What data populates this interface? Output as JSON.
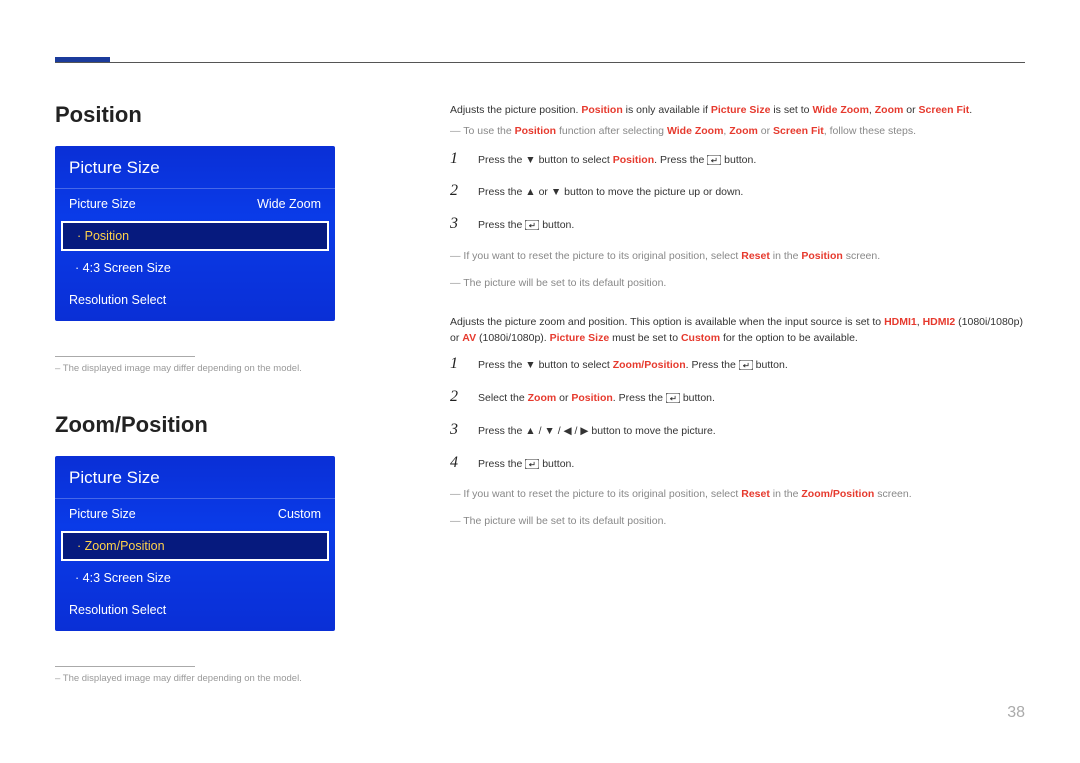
{
  "page_number": "38",
  "section1": {
    "heading": "Position",
    "menu": {
      "title": "Picture Size",
      "row_label": "Picture Size",
      "row_value": "Wide Zoom",
      "selected": "Position",
      "item2": "4:3 Screen Size",
      "last": "Resolution Select"
    },
    "footnote": "The displayed image may differ depending on the model.",
    "intro": {
      "pre": "Adjusts the picture position. ",
      "hl1": "Position",
      "mid1": " is only available if ",
      "hl2": "Picture Size",
      "mid2": " is set to ",
      "hl3": "Wide Zoom",
      "comma1": ", ",
      "hl4": "Zoom",
      "or": " or ",
      "hl5": "Screen Fit",
      "end": "."
    },
    "dash1_pre": "To use the ",
    "dash1_b1": "Position",
    "dash1_mid": " function after selecting ",
    "dash1_b2": "Wide Zoom",
    "dash1_c": ", ",
    "dash1_b3": "Zoom",
    "dash1_or": " or ",
    "dash1_b4": "Screen Fit",
    "dash1_end": ", follow these steps.",
    "steps": {
      "s1_a": "Press the ▼ button to select ",
      "s1_hl": "Position",
      "s1_b": ". Press the ",
      "s1_c": " button.",
      "s2": "Press the ▲ or ▼ button to move the picture up or down.",
      "s3_a": "Press the ",
      "s3_b": " button."
    },
    "dash2_a": "If you want to reset the picture to its original position, select ",
    "dash2_hl1": "Reset",
    "dash2_b": " in the ",
    "dash2_hl2": "Position",
    "dash2_c": " screen.",
    "dash3": "The picture will be set to its default position."
  },
  "section2": {
    "heading": "Zoom/Position",
    "menu": {
      "title": "Picture Size",
      "row_label": "Picture Size",
      "row_value": "Custom",
      "selected": "Zoom/Position",
      "item2": "4:3 Screen Size",
      "last": "Resolution Select"
    },
    "footnote": "The displayed image may differ depending on the model.",
    "intro_a": "Adjusts the picture zoom and position. This option is available when the input source is set to ",
    "intro_b1": "HDMI1",
    "intro_c1": ", ",
    "intro_b2": "HDMI2",
    "intro_c2": " (1080i/1080p) or ",
    "intro_b3": "AV",
    "intro_c3": " (1080i/1080p). ",
    "intro_b4": "Picture Size",
    "intro_c4": " must be set to ",
    "intro_b5": "Custom",
    "intro_c5": " for the option to be available.",
    "steps": {
      "s1_a": "Press the ▼ button to select ",
      "s1_hl": "Zoom/Position",
      "s1_b": ". Press the ",
      "s1_c": " button.",
      "s2_a": "Select the ",
      "s2_hl1": "Zoom",
      "s2_or": " or ",
      "s2_hl2": "Position",
      "s2_b": ". Press the ",
      "s2_c": " button.",
      "s3": "Press the ▲ / ▼ / ◀ / ▶ button to move the picture.",
      "s4_a": "Press the ",
      "s4_b": " button."
    },
    "dash2_a": "If you want to reset the picture to its original position, select ",
    "dash2_hl1": "Reset",
    "dash2_b": " in the ",
    "dash2_hl2": "Zoom/Position",
    "dash2_c": " screen.",
    "dash3": "The picture will be set to its default position."
  }
}
